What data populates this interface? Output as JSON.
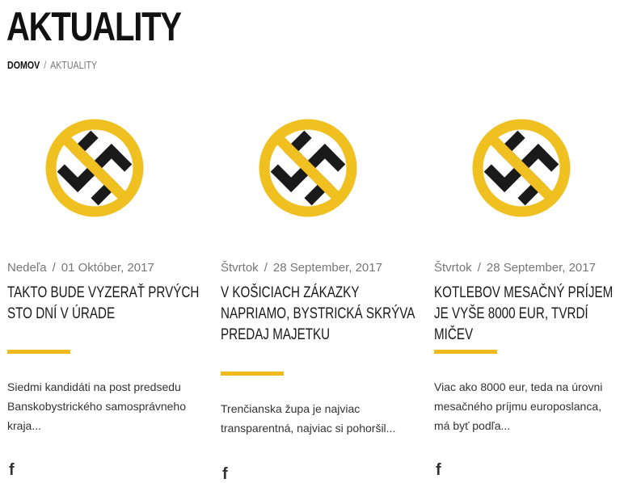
{
  "header": {
    "title": "AKTUALITY"
  },
  "breadcrumb": {
    "home": "DOMOV",
    "separator": "/",
    "current": "AKTUALITY"
  },
  "theme": {
    "accent": "#f3b81b",
    "icon_ring": "#f0c020",
    "icon_symbol": "#1a1a1a"
  },
  "articles": [
    {
      "day": "Nedeľa",
      "date": "01 Október, 2017",
      "title": "TAKTO BUDE VYZERAŤ PRVÝCH STO DNÍ V ÚRADE",
      "excerpt": "Siedmi kandidáti na post predsedu Banskobystrického samosprávneho kraja...",
      "image": "prohibited-swastika-icon",
      "share_icon": "facebook-icon"
    },
    {
      "day": "Štvrtok",
      "date": "28 September, 2017",
      "title": "V KOŠICIACH ZÁKAZKY NAPRIAMO, BYSTRICKÁ SKRÝVA PREDAJ MAJETKU",
      "excerpt": "Trenčianska župa je najviac transparentná, najviac si pohoršil...",
      "image": "prohibited-swastika-icon",
      "share_icon": "facebook-icon"
    },
    {
      "day": "Štvrtok",
      "date": "28 September, 2017",
      "title": "KOTLEBOV MESAČNÝ PRÍJEM JE VYŠE 8000 EUR, TVRDÍ MIČEV",
      "excerpt": "Viac ako 8000 eur, teda na úrovni mesačného príjmu europoslanca, má byť podľa...",
      "image": "prohibited-swastika-icon",
      "share_icon": "facebook-icon"
    }
  ]
}
